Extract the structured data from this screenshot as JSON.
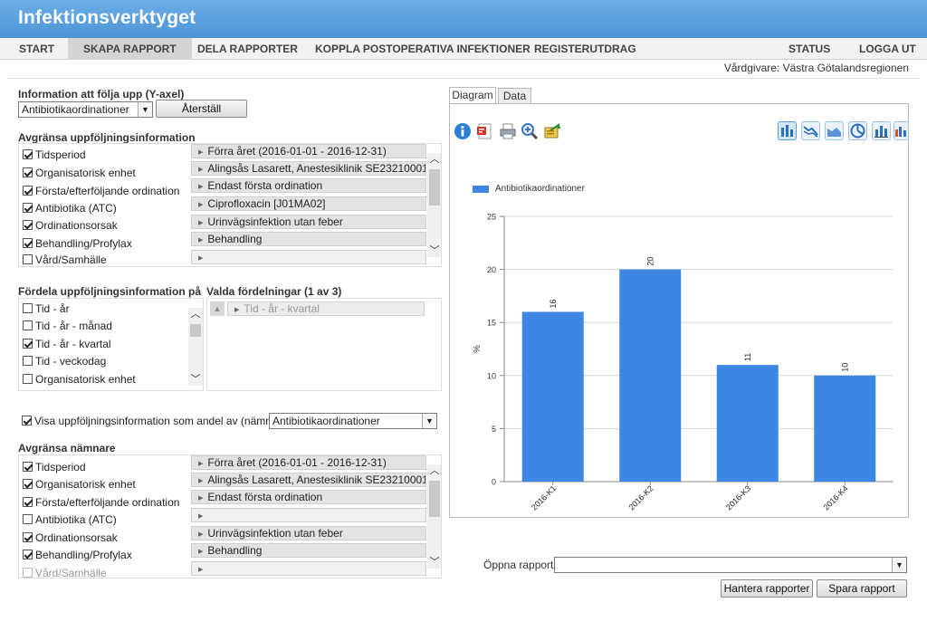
{
  "app": {
    "title": "Infektionsverktyget"
  },
  "nav": {
    "items": [
      "START",
      "SKAPA RAPPORT",
      "DELA RAPPORTER",
      "KOPPLA POSTOPERATIVA INFEKTIONER",
      "REGISTERUTDRAG"
    ],
    "right_items": [
      "STATUS",
      "LOGGA UT"
    ],
    "active": "SKAPA RAPPORT"
  },
  "user": {
    "vardgivare": "Vårdgivare: Västra Götalandsregionen"
  },
  "yaxis": {
    "label": "Information att följa upp (Y-axel)",
    "selected": "Antibiotikaordinationer",
    "reset_label": "Återställ"
  },
  "filter": {
    "label": "Avgränsa uppföljningsinformation",
    "items": [
      {
        "label": "Tidsperiod",
        "checked": true,
        "value": "Förra året (2016-01-01 - 2016-12-31)"
      },
      {
        "label": "Organisatorisk enhet",
        "checked": true,
        "value": "Alingsås Lasarett, Anestesiklinik SE2321000131"
      },
      {
        "label": "Första/efterföljande ordination",
        "checked": true,
        "value": "Endast första ordination"
      },
      {
        "label": "Antibiotika (ATC)",
        "checked": true,
        "value": "Ciprofloxacin [J01MA02]"
      },
      {
        "label": "Ordinationsorsak",
        "checked": true,
        "value": "Urinvägsinfektion utan feber"
      },
      {
        "label": "Behandling/Profylax",
        "checked": true,
        "value": "Behandling"
      },
      {
        "label": "Vård/Samhälle",
        "checked": false,
        "value": ""
      }
    ]
  },
  "distribute": {
    "label": "Fördela uppföljningsinformation på",
    "items": [
      {
        "label": "Tid - år",
        "checked": false
      },
      {
        "label": "Tid - år - månad",
        "checked": false
      },
      {
        "label": "Tid - år - kvartal",
        "checked": true
      },
      {
        "label": "Tid - veckodag",
        "checked": false
      },
      {
        "label": "Organisatorisk enhet",
        "checked": false
      }
    ],
    "selected_label": "Valda fördelningar (1 av 3)",
    "selected_items": [
      "Tid - år - kvartal"
    ]
  },
  "share": {
    "checked": true,
    "label": "Visa uppföljningsinformation som andel av (nämnare)",
    "selected": "Antibiotikaordinationer"
  },
  "denominator": {
    "label": "Avgränsa nämnare",
    "items": [
      {
        "label": "Tidsperiod",
        "checked": true,
        "disabled": false,
        "value": "Förra året (2016-01-01 - 2016-12-31)"
      },
      {
        "label": "Organisatorisk enhet",
        "checked": true,
        "disabled": false,
        "value": "Alingsås Lasarett, Anestesiklinik SE2321000131"
      },
      {
        "label": "Första/efterföljande ordination",
        "checked": true,
        "disabled": false,
        "value": "Endast första ordination"
      },
      {
        "label": "Antibiotika (ATC)",
        "checked": false,
        "disabled": false,
        "value": ""
      },
      {
        "label": "Ordinationsorsak",
        "checked": true,
        "disabled": false,
        "value": "Urinvägsinfektion utan feber"
      },
      {
        "label": "Behandling/Profylax",
        "checked": true,
        "disabled": false,
        "value": "Behandling"
      },
      {
        "label": "Vård/Samhälle",
        "checked": false,
        "disabled": true,
        "value": ""
      }
    ]
  },
  "tabs": [
    "Diagram",
    "Data"
  ],
  "toolbar_icons": [
    "info-icon",
    "pdf-icon",
    "print-icon",
    "zoom-icon",
    "export-icon"
  ],
  "chart_type_icons": [
    "bar-chart-icon",
    "line-chart-icon",
    "area-chart-icon",
    "pie-chart-icon",
    "stacked-bar-icon",
    "grouped-bar-icon"
  ],
  "chart_data": {
    "type": "bar",
    "categories": [
      "2016-K1",
      "2016-K2",
      "2016-K3",
      "2016-K4"
    ],
    "series": [
      {
        "name": "Antibiotikaordinationer",
        "values": [
          16,
          20,
          11,
          10
        ],
        "color": "#3d86e3"
      }
    ],
    "data_labels": [
      "16",
      "20",
      "11",
      "10"
    ],
    "ylabel": "%",
    "ylim": [
      0,
      25
    ],
    "yticks": [
      0,
      5,
      10,
      15,
      20,
      25
    ],
    "grid": true,
    "legend": "top-left"
  },
  "report": {
    "open_label": "Öppna rapport",
    "open_value": "",
    "manage_label": "Hantera rapporter",
    "save_label": "Spara rapport"
  }
}
